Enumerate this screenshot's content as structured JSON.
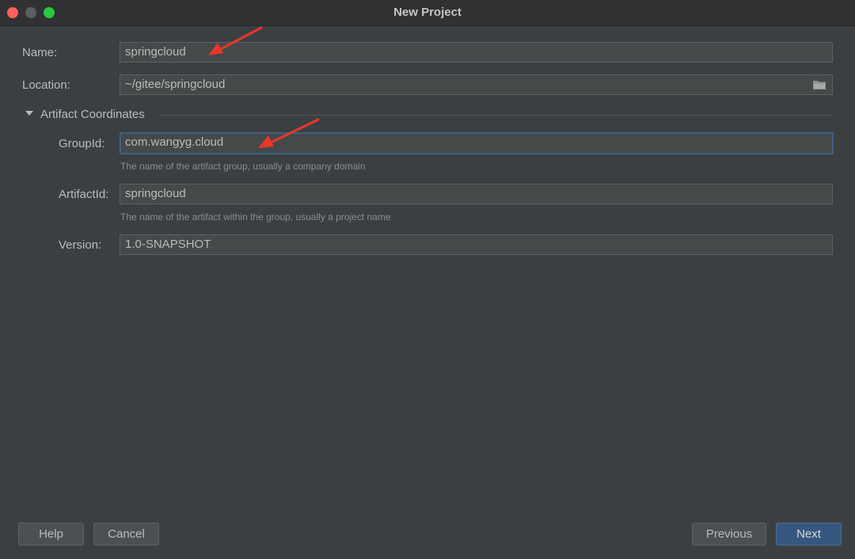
{
  "window": {
    "title": "New Project"
  },
  "form": {
    "name_label": "Name:",
    "name_value": "springcloud",
    "location_label": "Location:",
    "location_value": "~/gitee/springcloud",
    "section_title": "Artifact Coordinates",
    "groupid_label": "GroupId:",
    "groupid_value": "com.wangyg.cloud",
    "groupid_hint": "The name of the artifact group, usually a company domain",
    "artifactid_label": "ArtifactId:",
    "artifactid_value": "springcloud",
    "artifactid_hint": "The name of the artifact within the group, usually a project name",
    "version_label": "Version:",
    "version_value": "1.0-SNAPSHOT"
  },
  "buttons": {
    "help": "Help",
    "cancel": "Cancel",
    "previous": "Previous",
    "next": "Next"
  },
  "icons": {
    "folder": "folder-icon",
    "collapse": "triangle-down-icon"
  },
  "colors": {
    "background": "#3c3f41",
    "field": "#45494a",
    "focus_border": "#3d6185",
    "primary_button": "#365880",
    "annotation_arrow": "#e8372a"
  }
}
